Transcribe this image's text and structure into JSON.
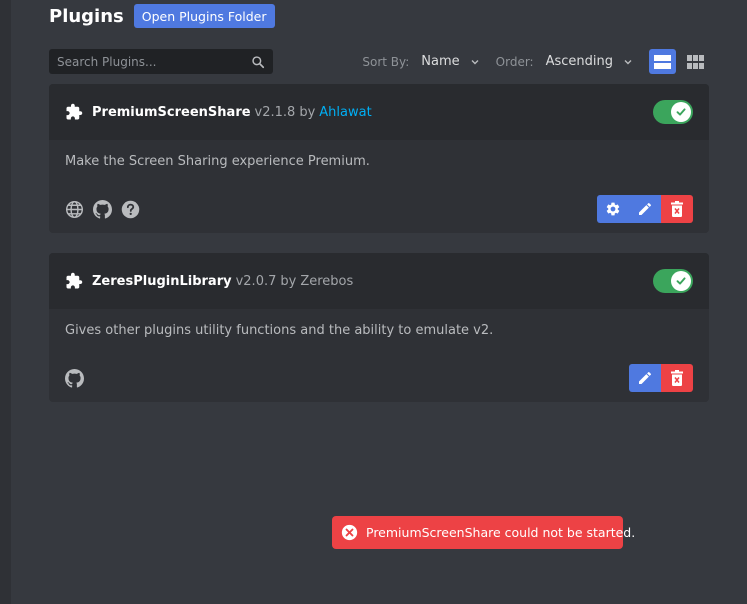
{
  "header": {
    "title": "Plugins",
    "open_folder_label": "Open Plugins Folder"
  },
  "search": {
    "placeholder": "Search Plugins..."
  },
  "sort": {
    "sort_by_label": "Sort By:",
    "sort_by_value": "Name",
    "order_label": "Order:",
    "order_value": "Ascending"
  },
  "view": {
    "active": "list",
    "options": [
      "list",
      "grid"
    ]
  },
  "plugins": [
    {
      "name": "PremiumScreenShare",
      "version": "v2.1.8",
      "by": "by",
      "author": "Ahlawat",
      "author_is_link": true,
      "enabled": true,
      "description": "Make the Screen Sharing experience Premium.",
      "links": [
        "globe-icon",
        "github-icon",
        "help-icon"
      ],
      "actions": [
        "settings",
        "edit",
        "delete"
      ]
    },
    {
      "name": "ZeresPluginLibrary",
      "version": "v2.0.7",
      "by": "by",
      "author": "Zerebos",
      "author_is_link": false,
      "enabled": true,
      "description": "Gives other plugins utility functions and the ability to emulate v2.",
      "links": [
        "github-icon"
      ],
      "actions": [
        "edit",
        "delete"
      ]
    }
  ],
  "toast": {
    "text": "PremiumScreenShare could not be started.",
    "type": "error"
  },
  "colors": {
    "accent": "#4f79e0",
    "danger": "#ed4245",
    "toggle_on": "#3ba55c",
    "link": "#00aff4",
    "background": "#36393f",
    "card": "#2f3136"
  }
}
